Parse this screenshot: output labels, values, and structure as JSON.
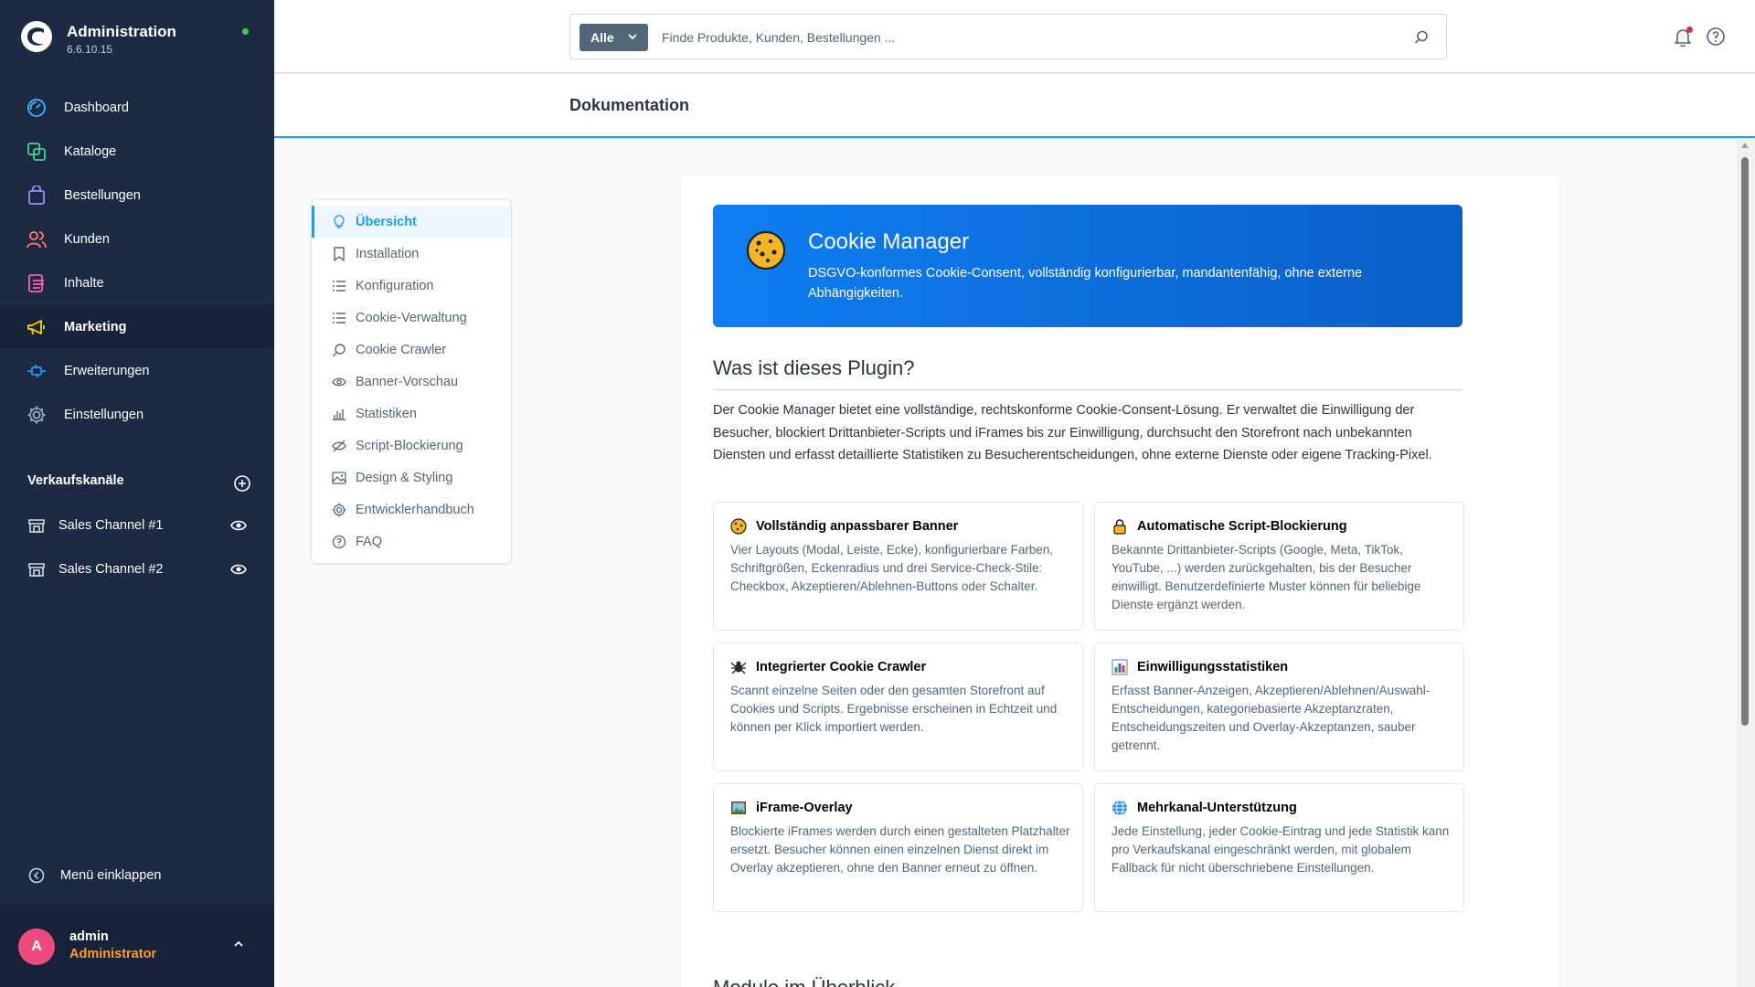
{
  "app": {
    "title": "Administration",
    "version": "6.6.10.15"
  },
  "sidebar": {
    "items": [
      {
        "label": "Dashboard"
      },
      {
        "label": "Kataloge"
      },
      {
        "label": "Bestellungen"
      },
      {
        "label": "Kunden"
      },
      {
        "label": "Inhalte"
      },
      {
        "label": "Marketing"
      },
      {
        "label": "Erweiterungen"
      },
      {
        "label": "Einstellungen"
      }
    ],
    "sales_channels_title": "Verkaufskanäle",
    "sales_channels": [
      {
        "label": "Sales Channel #1"
      },
      {
        "label": "Sales Channel #2"
      }
    ],
    "collapse_label": "Menü einklappen",
    "user": {
      "initial": "A",
      "name": "admin",
      "role": "Administrator"
    }
  },
  "search": {
    "type_label": "Alle",
    "placeholder": "Finde Produkte, Kunden, Bestellungen ..."
  },
  "page": {
    "title": "Dokumentation"
  },
  "doc_nav": {
    "items": [
      {
        "label": "Übersicht",
        "icon": "lightbulb-icon"
      },
      {
        "label": "Installation",
        "icon": "bookmark-icon"
      },
      {
        "label": "Konfiguration",
        "icon": "list-icon"
      },
      {
        "label": "Cookie-Verwaltung",
        "icon": "list-icon"
      },
      {
        "label": "Cookie Crawler",
        "icon": "search-icon"
      },
      {
        "label": "Banner-Vorschau",
        "icon": "eye-icon"
      },
      {
        "label": "Statistiken",
        "icon": "chart-icon"
      },
      {
        "label": "Script-Blockierung",
        "icon": "eye-slash-icon"
      },
      {
        "label": "Design & Styling",
        "icon": "image-icon"
      },
      {
        "label": "Entwicklerhandbuch",
        "icon": "gear-icon"
      },
      {
        "label": "FAQ",
        "icon": "question-icon"
      }
    ]
  },
  "hero": {
    "title": "Cookie Manager",
    "subtitle": "DSGVO-konformes Cookie-Consent, vollständig konfigurierbar, mandantenfähig, ohne externe Abhängigkeiten."
  },
  "sections": {
    "what_is": "Was ist dieses Plugin?",
    "modules": "Module im Überblick"
  },
  "intro": "Der Cookie Manager bietet eine vollständige, rechtskonforme Cookie-Consent-Lösung. Er verwaltet die Einwilligung der Besucher, blockiert Drittanbieter-Scripts und iFrames bis zur Einwilligung, durchsucht den Storefront nach unbekannten Diensten und erfasst detaillierte Statistiken zu Besucherentscheidungen, ohne externe Dienste oder eigene Tracking-Pixel.",
  "features": [
    {
      "title": "Vollständig anpassbarer Banner",
      "icon": "cookie-icon",
      "text": "Vier Layouts (Modal, Leiste, Ecke), konfigurierbare Farben, Schriftgrößen, Eckenradius und drei Service-Check-Stile: Checkbox, Akzeptieren/Ablehnen-Buttons oder Schalter."
    },
    {
      "title": "Automatische Script-Blockierung",
      "icon": "lock-icon",
      "text": "Bekannte Drittanbieter-Scripts (Google, Meta, TikTok, YouTube, ...) werden zurückgehalten, bis der Besucher einwilligt. Benutzerdefinierte Muster können für beliebige Dienste ergänzt werden."
    },
    {
      "title": "Integrierter Cookie Crawler",
      "icon": "spider-icon",
      "text": "Scannt einzelne Seiten oder den gesamten Storefront auf Cookies und Scripts. Ergebnisse erscheinen in Echtzeit und können per Klick importiert werden."
    },
    {
      "title": "Einwilligungsstatistiken",
      "icon": "bar-chart-icon",
      "text": "Erfasst Banner-Anzeigen, Akzeptieren/Ablehnen/Auswahl-Entscheidungen, kategoriebasierte Akzeptanzraten, Entscheidungszeiten und Overlay-Akzeptanzen, sauber getrennt."
    },
    {
      "title": "iFrame-Overlay",
      "icon": "picture-icon",
      "text": "Blockierte iFrames werden durch einen gestalteten Platzhalter ersetzt. Besucher können einen einzelnen Dienst direkt im Overlay akzeptieren, ohne den Banner erneut zu öffnen."
    },
    {
      "title": "Mehrkanal-Unterstützung",
      "icon": "globe-icon",
      "text": "Jede Einstellung, jeder Cookie-Eintrag und jede Statistik kann pro Verkaufskanal eingeschränkt werden, mit globalem Fallback für nicht überschriebene Einstellungen."
    }
  ],
  "colors": {
    "sidebar_bg": "#1c2a44",
    "accent": "#189eff",
    "role_color": "#ff9e2c",
    "avatar_bg": "#ec4c7c"
  }
}
